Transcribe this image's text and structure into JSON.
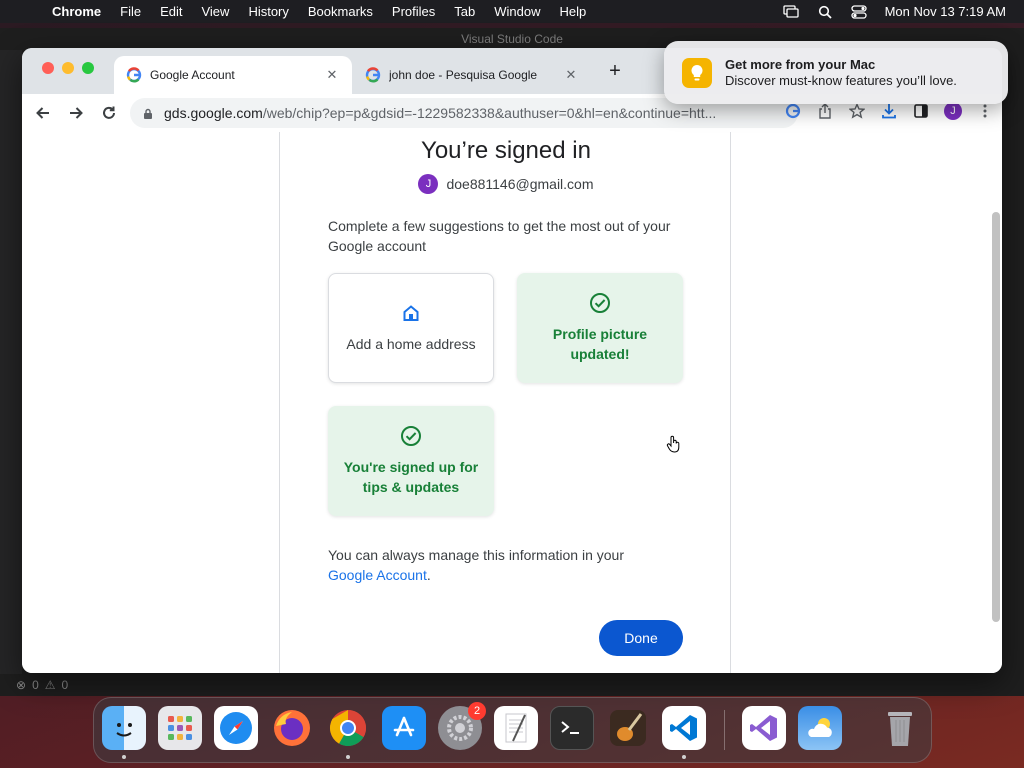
{
  "menubar": {
    "app": "Chrome",
    "items": [
      "File",
      "Edit",
      "View",
      "History",
      "Bookmarks",
      "Profiles",
      "Tab",
      "Window",
      "Help"
    ],
    "clock": "Mon Nov 13  7:19 AM"
  },
  "vscode": {
    "title": "Visual Studio Code",
    "status_errors": "0",
    "status_warnings": "0"
  },
  "chrome": {
    "tabs": [
      {
        "title": "Google Account",
        "active": true,
        "icon": "google-icon"
      },
      {
        "title": "john doe - Pesquisa Google",
        "active": false,
        "icon": "google-icon"
      }
    ],
    "url_host": "gds.google.com",
    "url_path": "/web/chip?ep=p&gdsid=-1229582338&authuser=0&hl=en&continue=htt...",
    "profile_initial": "J"
  },
  "page": {
    "heading": "You’re signed in",
    "account_initial": "J",
    "account_email": "doe881146@gmail.com",
    "intro": "Complete a few suggestions to get the most out of your Google account",
    "tiles": [
      {
        "label": "Add a home address",
        "state": "pending",
        "icon": "home-icon"
      },
      {
        "label": "Profile picture updated!",
        "state": "done",
        "icon": "check-circle-icon"
      },
      {
        "label": "You're signed up for tips & updates",
        "state": "done",
        "icon": "check-circle-icon"
      }
    ],
    "footnote_prefix": "You can always manage this information in your",
    "footnote_link": "Google Account",
    "footnote_suffix": ".",
    "done_label": "Done"
  },
  "notification": {
    "title": "Get more from your Mac",
    "body": "Discover must-know features you’ll love.",
    "icon": "lightbulb-icon"
  },
  "dock": {
    "apps": [
      "Finder",
      "Launchpad",
      "Safari",
      "Firefox",
      "Chrome",
      "App Store",
      "System Settings",
      "TextEdit",
      "Terminal",
      "GarageBand",
      "Visual Studio Code",
      "Visual Studio",
      "Weather",
      "Trash"
    ],
    "settings_badge": "2"
  },
  "colors": {
    "accent": "#0b57d0",
    "success_bg": "#e6f4ea",
    "success_text": "#188038",
    "avatar": "#7b2fbf"
  }
}
